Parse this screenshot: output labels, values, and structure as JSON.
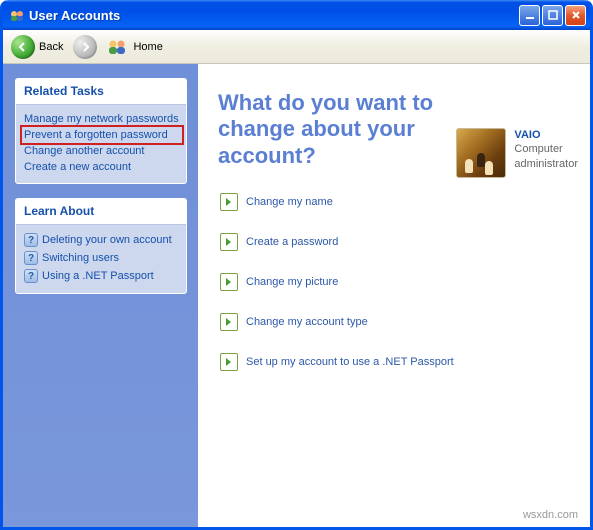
{
  "window": {
    "title": "User Accounts"
  },
  "toolbar": {
    "back": "Back",
    "home": "Home"
  },
  "sidebar": {
    "relatedTasks": {
      "title": "Related Tasks",
      "items": [
        "Manage my network passwords",
        "Prevent a forgotten password",
        "Change another account",
        "Create a new account"
      ]
    },
    "learnAbout": {
      "title": "Learn About",
      "items": [
        "Deleting your own account",
        "Switching users",
        "Using a .NET Passport"
      ]
    }
  },
  "main": {
    "heading": "What do you want to change about your account?",
    "options": [
      "Change my name",
      "Create a password",
      "Change my picture",
      "Change my account type",
      "Set up my account to use a .NET Passport"
    ]
  },
  "user": {
    "name": "VAIO",
    "role1": "Computer",
    "role2": "administrator"
  },
  "watermark": "wsxdn.com"
}
